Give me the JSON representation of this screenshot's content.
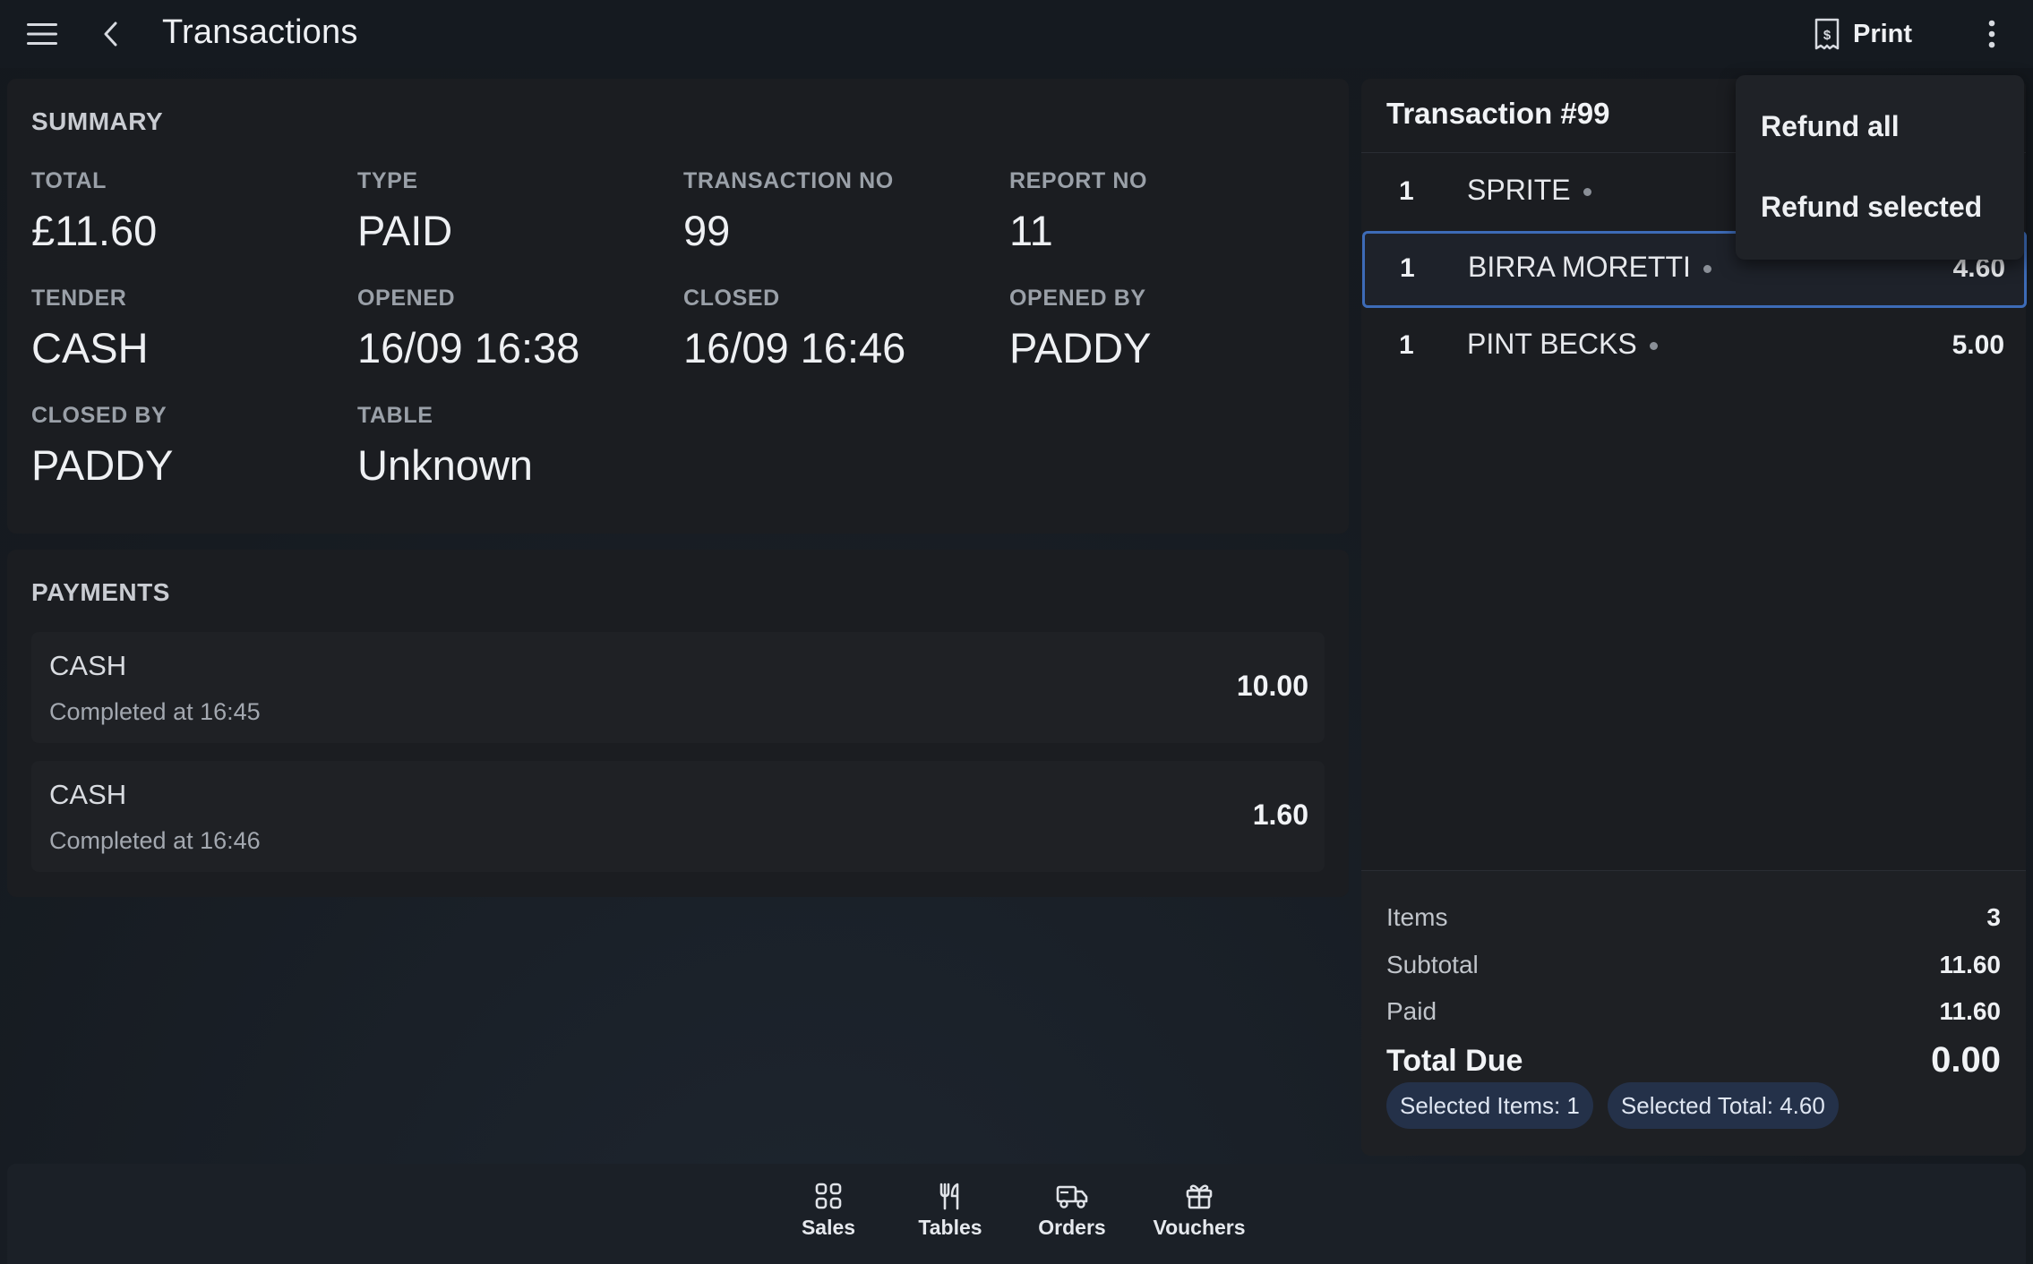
{
  "header": {
    "title": "Transactions",
    "print_label": "Print"
  },
  "summary": {
    "section_title": "SUMMARY",
    "fields": [
      {
        "label": "TOTAL",
        "value": "£11.60"
      },
      {
        "label": "TYPE",
        "value": "PAID"
      },
      {
        "label": "TRANSACTION NO",
        "value": "99"
      },
      {
        "label": "REPORT NO",
        "value": "11"
      },
      {
        "label": "TENDER",
        "value": "CASH"
      },
      {
        "label": "OPENED",
        "value": "16/09 16:38"
      },
      {
        "label": "CLOSED",
        "value": "16/09 16:46"
      },
      {
        "label": "OPENED BY",
        "value": "PADDY"
      },
      {
        "label": "CLOSED BY",
        "value": "PADDY"
      },
      {
        "label": "TABLE",
        "value": "Unknown"
      }
    ]
  },
  "payments": {
    "section_title": "PAYMENTS",
    "rows": [
      {
        "method": "CASH",
        "time": "Completed at 16:45",
        "amount": "10.00"
      },
      {
        "method": "CASH",
        "time": "Completed at 16:46",
        "amount": "1.60"
      }
    ]
  },
  "transaction": {
    "title": "Transaction #99",
    "items": [
      {
        "qty": "1",
        "name": "SPRITE",
        "price": ""
      },
      {
        "qty": "1",
        "name": "BIRRA MORETTI",
        "price": "4.60",
        "selected": true
      },
      {
        "qty": "1",
        "name": "PINT BECKS",
        "price": "5.00"
      }
    ],
    "totals": {
      "items_label": "Items",
      "items_value": "3",
      "subtotal_label": "Subtotal",
      "subtotal_value": "11.60",
      "paid_label": "Paid",
      "paid_value": "11.60",
      "due_label": "Total Due",
      "due_value": "0.00"
    },
    "chips": {
      "selected_items": "Selected Items: 1",
      "selected_total": "Selected Total: 4.60"
    }
  },
  "dropdown": {
    "items": [
      "Refund all",
      "Refund selected"
    ]
  },
  "bottom_nav": {
    "items": [
      {
        "label": "Sales",
        "icon": "grid-icon"
      },
      {
        "label": "Tables",
        "icon": "cutlery-icon"
      },
      {
        "label": "Orders",
        "icon": "truck-icon"
      },
      {
        "label": "Vouchers",
        "icon": "gift-icon"
      }
    ]
  },
  "colors": {
    "background": "#151a20",
    "card": "#1b1d21",
    "selected_border": "#3d6bb7",
    "chip": "#243149"
  }
}
